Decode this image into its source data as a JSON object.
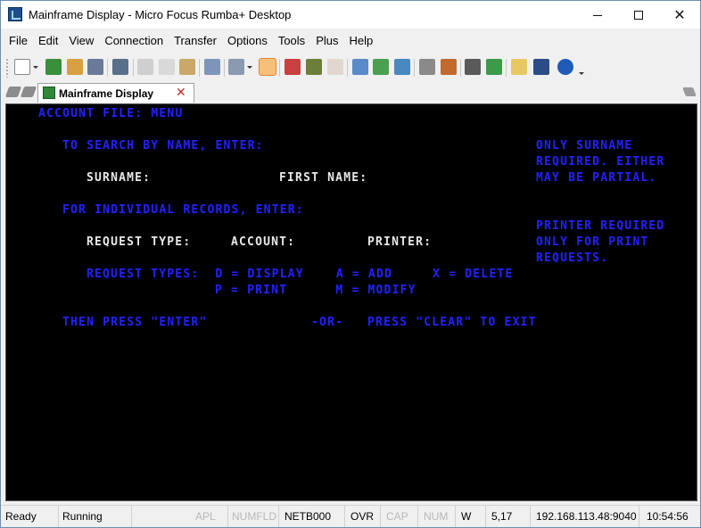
{
  "window": {
    "title": "Mainframe Display - Micro Focus Rumba+ Desktop"
  },
  "menu": {
    "items": [
      "File",
      "Edit",
      "View",
      "Connection",
      "Transfer",
      "Options",
      "Tools",
      "Plus",
      "Help"
    ]
  },
  "toolbar": {
    "icons": [
      "new-session-icon",
      "open-icon",
      "connect-icon",
      "disconnect-icon",
      "save-icon",
      "print-screen-icon",
      "cut-icon",
      "copy-icon",
      "paste-icon",
      "undo-icon",
      "window-layout-icon",
      "session-manager-icon",
      "macro-record-icon",
      "keyboard-map-icon",
      "calendar-icon",
      "file-send-icon",
      "file-receive-icon",
      "transfer-icon",
      "settings-icon",
      "brush-icon",
      "run-macro-icon",
      "play-icon",
      "notes-icon",
      "hotspot-icon",
      "help-icon"
    ]
  },
  "tabs": {
    "active_label": "Mainframe Display",
    "close_glyph": "✕"
  },
  "screen": {
    "title": "ACCOUNT FILE: MENU",
    "search_prompt": "TO SEARCH BY NAME, ENTER:",
    "surname_label": "SURNAME:",
    "first_name_label": "FIRST NAME:",
    "note1_line1": "ONLY SURNAME",
    "note1_line2": "REQUIRED. EITHER",
    "note1_line3": "MAY BE PARTIAL.",
    "individual_prompt": "FOR INDIVIDUAL RECORDS, ENTER:",
    "note2_line1": "PRINTER REQUIRED",
    "note2_line2": "ONLY FOR PRINT",
    "note2_line3": "REQUESTS.",
    "request_type_label": "REQUEST TYPE:",
    "account_label": "ACCOUNT:",
    "printer_label": "PRINTER:",
    "types_line1": "REQUEST TYPES:  D = DISPLAY    A = ADD     X = DELETE",
    "types_line2": "P = PRINT      M = MODIFY",
    "enter_instruction": "THEN PRESS \"ENTER\"",
    "or_text": "-OR-",
    "clear_instruction": "PRESS \"CLEAR\" TO EXIT"
  },
  "status": {
    "ready": "Ready",
    "running": "Running",
    "apl": "APL",
    "numfld": "NUMFLD",
    "netb": "NETB000",
    "ovr": "OVR",
    "cap": "CAP",
    "num": "NUM",
    "w": "W",
    "cursor": "5,17",
    "address": "192.168.113.48:9040",
    "time": "10:54:56"
  },
  "colors": {
    "terminal_bg": "#000000",
    "field_blue": "#2222ff",
    "label_white": "#e8e8e8"
  }
}
